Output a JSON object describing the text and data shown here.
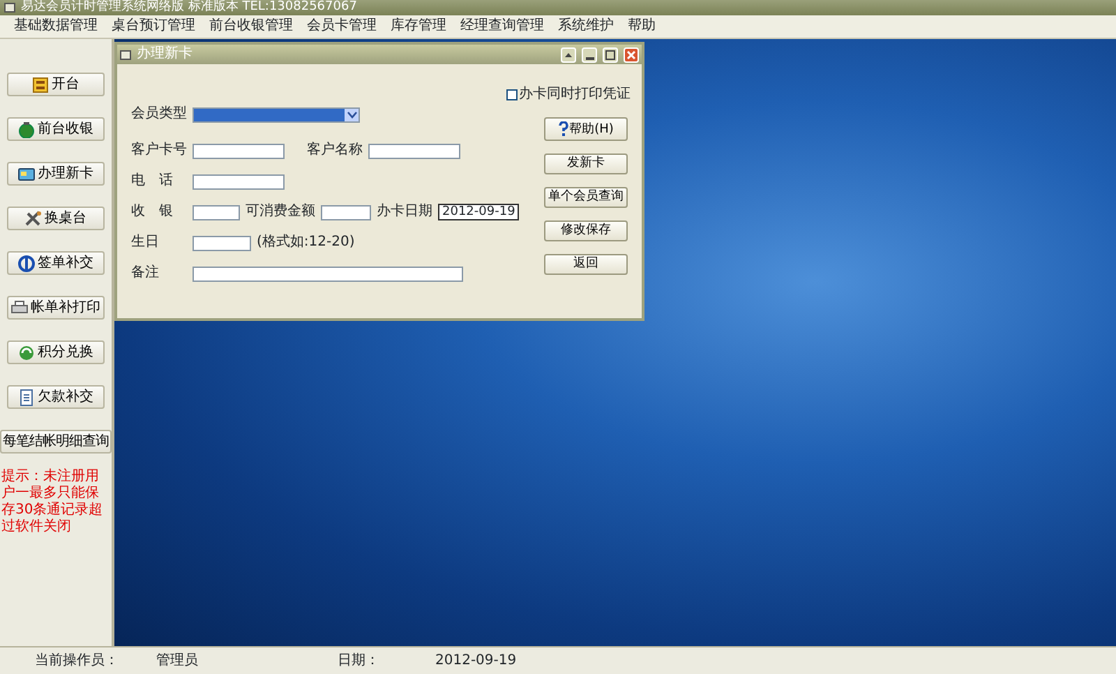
{
  "window": {
    "title": "易达会员计时管理系统网络版  标准版本  TEL:13082567067"
  },
  "menu": [
    "基础数据管理",
    "桌台预订管理",
    "前台收银管理",
    "会员卡管理",
    "库存管理",
    "经理查询管理",
    "系统维护",
    "帮助"
  ],
  "sidebar": {
    "buttons": [
      {
        "label": "开台",
        "kind": "table"
      },
      {
        "label": "前台收银",
        "kind": "money"
      },
      {
        "label": "办理新卡",
        "kind": "card"
      },
      {
        "label": "换桌台",
        "kind": "tools"
      },
      {
        "label": "签单补交",
        "kind": "sign"
      },
      {
        "label": "帐单补打印",
        "kind": "printer"
      },
      {
        "label": "积分兑换",
        "kind": "exchange"
      },
      {
        "label": "欠款补交",
        "kind": "document"
      },
      {
        "label": "每笔结帐明细查询",
        "kind": "text"
      }
    ],
    "notice": "提示：未注册用户一最多只能保存30条通记录超过软件关闭"
  },
  "dialog": {
    "title": "办理新卡",
    "print_checkbox": {
      "label": "办卡同时打印凭证",
      "checked": false
    },
    "member_type": {
      "label": "会员类型",
      "focused": true
    },
    "card_no": {
      "label": "客户卡号"
    },
    "customer_name": {
      "label": "客户名称"
    },
    "phone": {
      "label": "电　话"
    },
    "receipt": {
      "label": "收　银"
    },
    "spendable": {
      "label": "可消费金额"
    },
    "card_date": {
      "label": "办卡日期",
      "value": "2012-09-19"
    },
    "birthday": {
      "label": "生日",
      "hint": "(格式如:12-20)"
    },
    "note": {
      "label": "备注"
    },
    "help_button": "帮助(H)",
    "buttons": [
      "发新卡",
      "单个会员查询",
      "修改保存",
      "返回"
    ]
  },
  "status_bar": {
    "operator_label": "当前操作员：",
    "operator": "管理员",
    "date_label": "日期：",
    "date": "2012-09-19"
  }
}
